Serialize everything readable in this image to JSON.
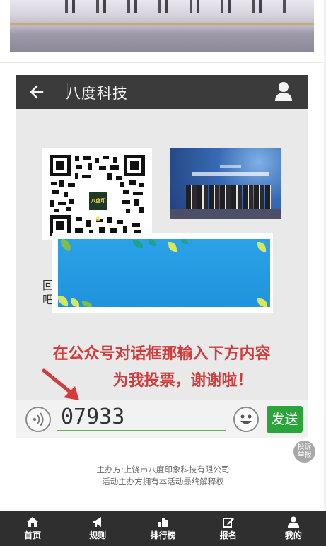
{
  "poster": {
    "header": {
      "title": "八度科技"
    },
    "qr_logo_text": "八度印象",
    "hidden_text": "回\n吧",
    "instruction_line1": "在公众号对话框那输入下方内容",
    "instruction_line2": "为我投票，谢谢啦！",
    "chat": {
      "input_value": "07933",
      "send_label": "发送"
    }
  },
  "report_button": "投诉\n举报",
  "footer": {
    "organizer": "主办方:上饶市八度印象科技有限公司",
    "rights": "活动主办方拥有本活动最终解释权"
  },
  "nav": [
    {
      "label": "首页",
      "icon": "home-icon"
    },
    {
      "label": "规则",
      "icon": "megaphone-icon"
    },
    {
      "label": "排行榜",
      "icon": "bar-chart-icon"
    },
    {
      "label": "报名",
      "icon": "edit-icon"
    },
    {
      "label": "我的",
      "icon": "user-icon"
    }
  ],
  "colors": {
    "header_bg": "#3b3b3b",
    "instruction_red": "#d23c3c",
    "send_green": "#2aa53b",
    "ad_blue": "#2ba2e8",
    "nav_bg": "#2f2f2f"
  }
}
